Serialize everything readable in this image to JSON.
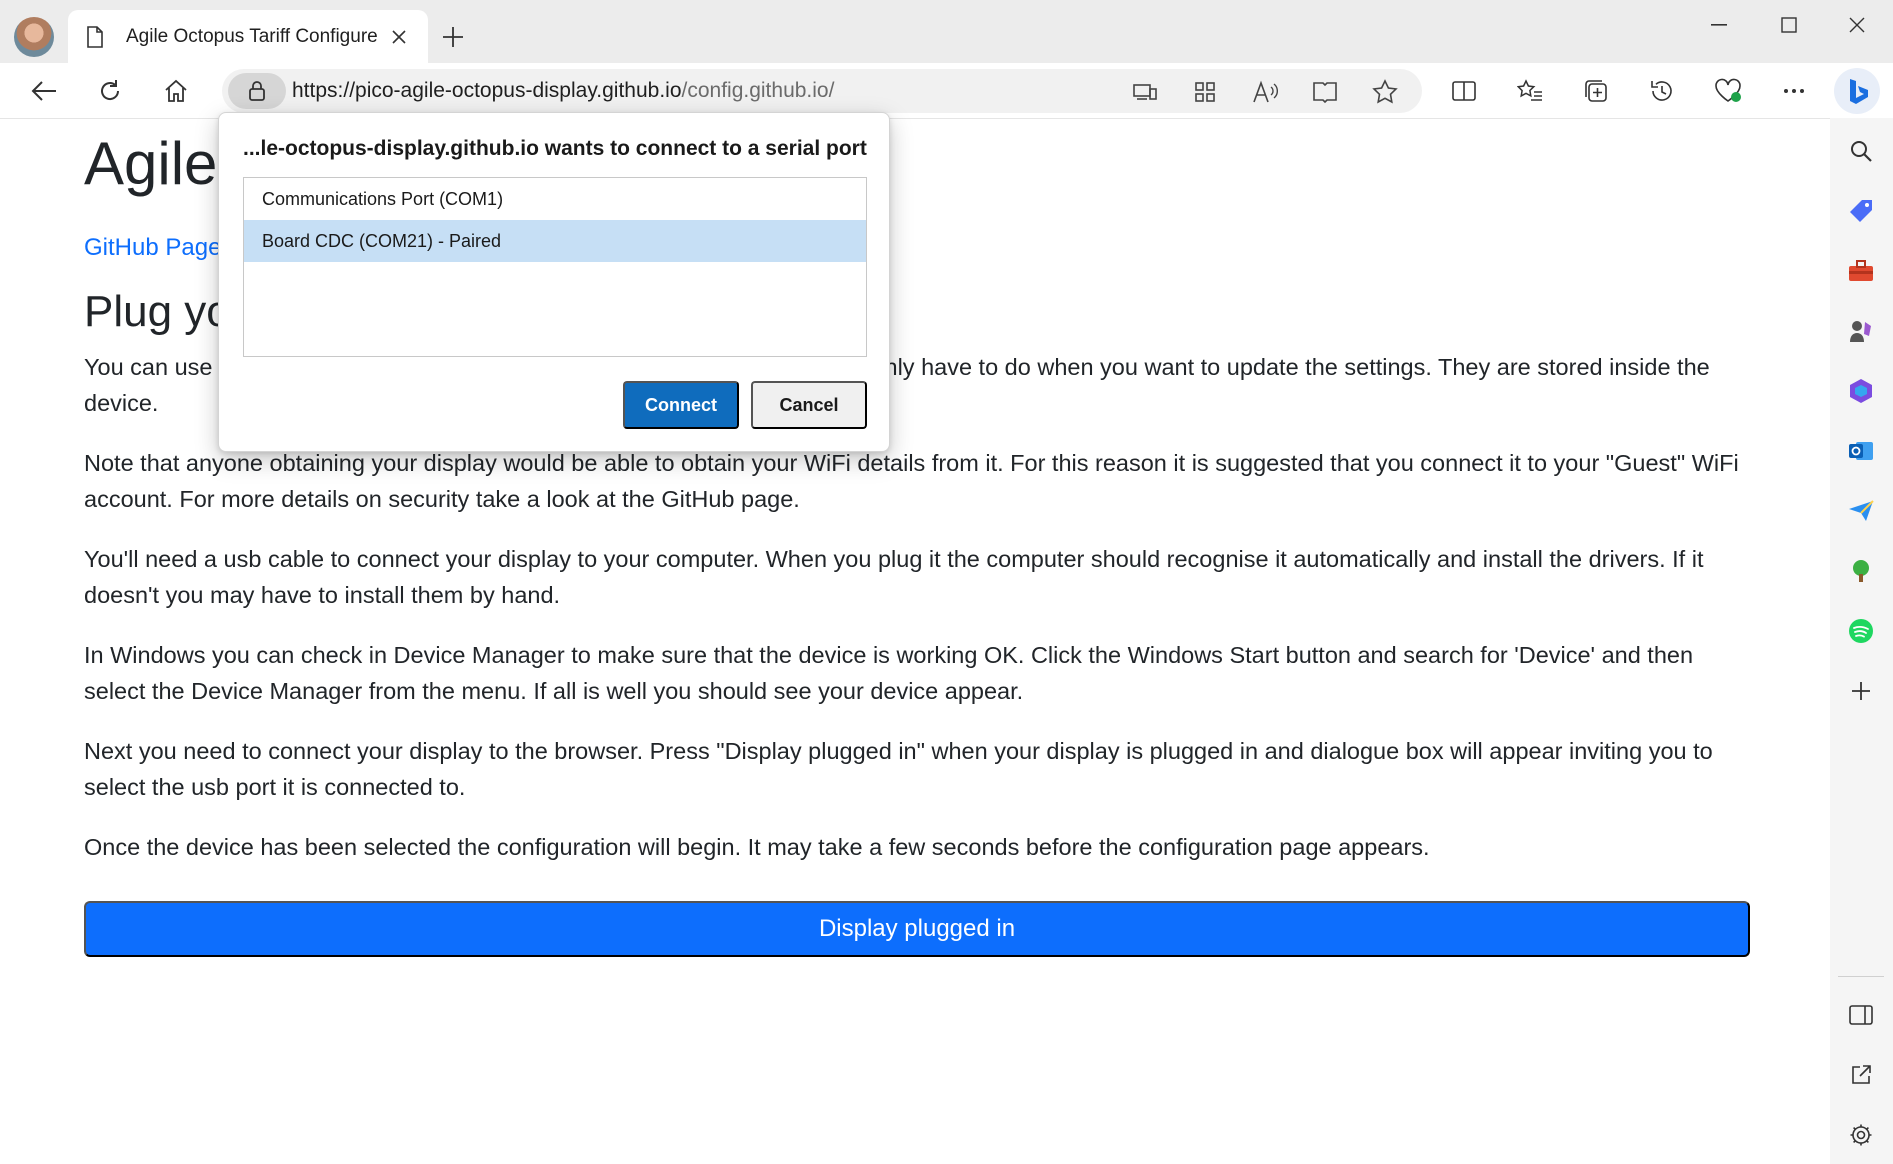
{
  "tab": {
    "title": "Agile Octopus Tariff Configure"
  },
  "address_bar": {
    "url_host": "https://pico-agile-octopus-display.github.io",
    "url_path": "/config.github.io/"
  },
  "page": {
    "title": "Agile",
    "github_link": "GitHub Page",
    "heading": "Plug yo",
    "para1_start": "You can use",
    "para1_end": "nly have to do when you want to update the settings. They are stored inside the",
    "para1_line2": "device.",
    "para2": "Note that anyone obtaining your display would be able to obtain your WiFi details from it. For this reason it is suggested that you connect it to your \"Guest\" WiFi account. For more details on security take a look at the GitHub page.",
    "para3": "You'll need a usb cable to connect your display to your computer. When you plug it the computer should recognise it automatically and install the drivers. If it doesn't you may have to install them by hand.",
    "para4": "In Windows you can check in Device Manager to make sure that the device is working OK. Click the Windows Start button and search for 'Device' and then select the Device Manager from the menu. If all is well you should see your device appear.",
    "para5": "Next you need to connect your display to the browser. Press \"Display plugged in\" when your display is plugged in and dialogue box will appear inviting you to select the usb port it is connected to.",
    "para6": "Once the device has been selected the configuration will begin. It may take a few seconds before the configuration page appears.",
    "cta_label": "Display plugged in"
  },
  "dialog": {
    "title": "...le-octopus-display.github.io wants to connect to a serial port",
    "ports": [
      {
        "label": "Communications Port (COM1)",
        "selected": false
      },
      {
        "label": "Board CDC (COM21) - Paired",
        "selected": true
      }
    ],
    "connect_label": "Connect",
    "cancel_label": "Cancel"
  },
  "colors": {
    "accent": "#0d6efd",
    "dialog_primary": "#0f6cbd",
    "selected_row": "#c6dff5"
  }
}
